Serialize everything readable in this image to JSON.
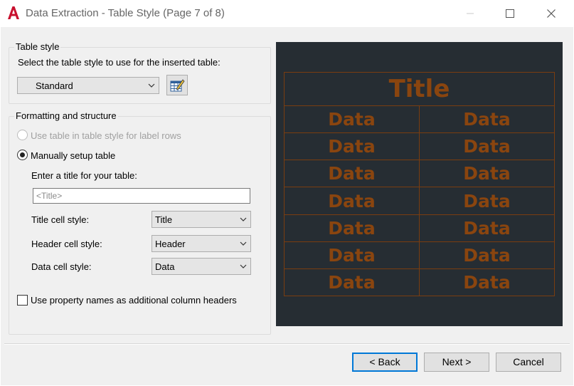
{
  "window": {
    "title": "Data Extraction - Table Style (Page 7 of 8)",
    "logo_letter": "A"
  },
  "table_style_group": {
    "legend": "Table style",
    "prompt": "Select the table style to use for the inserted table:",
    "selected_style": "Standard"
  },
  "formatting_group": {
    "legend": "Formatting and structure",
    "option_label_rows": "Use table in table style for label rows",
    "option_label_rows_selected": false,
    "option_label_rows_enabled": false,
    "option_manual": "Manually setup table",
    "option_manual_selected": true,
    "title_prompt": "Enter a title for your table:",
    "title_value": "",
    "title_placeholder": "<Title>",
    "title_cell_style_label": "Title cell style:",
    "title_cell_style_value": "Title",
    "header_cell_style_label": "Header cell style:",
    "header_cell_style_value": "Header",
    "data_cell_style_label": "Data cell style:",
    "data_cell_style_value": "Data",
    "property_names_label": "Use property names as additional column headers",
    "property_names_checked": false
  },
  "preview": {
    "title": "Title",
    "rows": [
      [
        "Data",
        "Data"
      ],
      [
        "Data",
        "Data"
      ],
      [
        "Data",
        "Data"
      ],
      [
        "Data",
        "Data"
      ],
      [
        "Data",
        "Data"
      ],
      [
        "Data",
        "Data"
      ],
      [
        "Data",
        "Data"
      ]
    ],
    "background_color": "#262d33",
    "text_color": "#8a450f",
    "line_color": "#7a3d10"
  },
  "buttons": {
    "back": "< Back",
    "next": "Next >",
    "cancel": "Cancel"
  }
}
